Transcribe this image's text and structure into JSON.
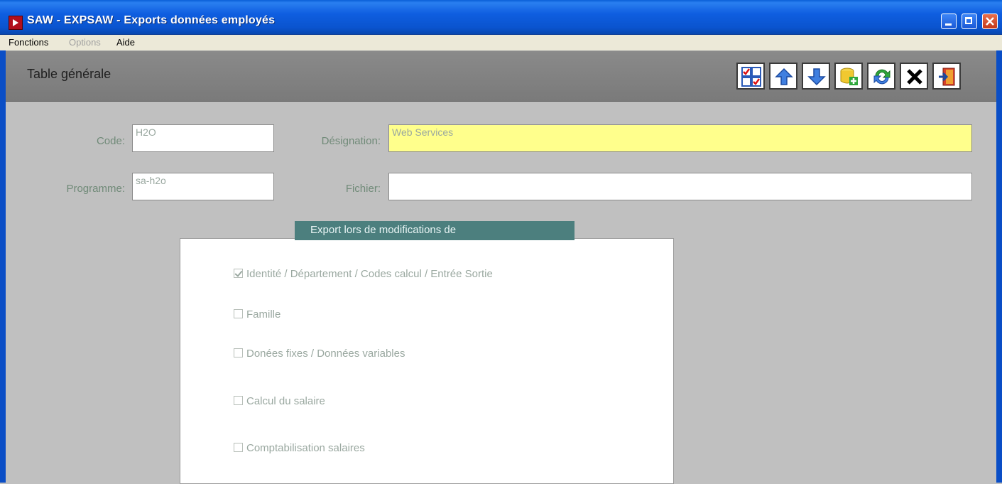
{
  "window": {
    "title": "SAW - EXPSAW - Exports données employés",
    "colors": {
      "titlebar": "#0a54cf",
      "close": "#c3381a"
    }
  },
  "menu": [
    {
      "label": "Fonctions",
      "enabled": true
    },
    {
      "label": "Options",
      "enabled": false
    },
    {
      "label": "Aide",
      "enabled": true
    }
  ],
  "header": {
    "title": "Table générale",
    "toolbar": [
      {
        "icon": "checklist-grid-icon"
      },
      {
        "icon": "arrow-up-icon"
      },
      {
        "icon": "arrow-down-icon"
      },
      {
        "icon": "add-record-icon"
      },
      {
        "icon": "refresh-icon"
      },
      {
        "icon": "delete-icon"
      },
      {
        "icon": "exit-icon"
      }
    ]
  },
  "form": {
    "code": {
      "label": "Code:",
      "value": "H2O"
    },
    "designation": {
      "label": "Désignation:",
      "value": "Web Services",
      "highlight": "#ffff8c"
    },
    "programme": {
      "label": "Programme:",
      "value": "sa-h2o"
    },
    "fichier": {
      "label": "Fichier:",
      "value": ""
    }
  },
  "export_group": {
    "title": "Export lors de modifications de",
    "options": [
      {
        "label": "Identité / Département / Codes calcul / Entrée Sortie",
        "checked": true
      },
      {
        "label": "Famille",
        "checked": false
      },
      {
        "label": "Donées fixes / Données variables",
        "checked": false
      },
      {
        "label": "Calcul du salaire",
        "checked": false
      },
      {
        "label": "Comptabilisation salaires",
        "checked": false
      }
    ]
  }
}
